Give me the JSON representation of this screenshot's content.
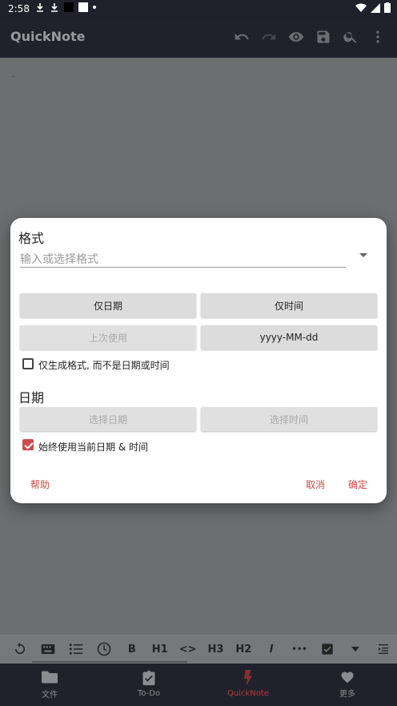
{
  "status_bar": {
    "time": "2:58"
  },
  "app_bar": {
    "title": "QuickNote"
  },
  "dialog": {
    "format_heading": "格式",
    "format_placeholder": "输入或选择格式",
    "buttons": {
      "date_only": "仅日期",
      "time_only": "仅时间",
      "last_used": "上次使用",
      "preset": "yyyy-MM-dd"
    },
    "format_only_checkbox": {
      "label": "仅生成格式, 而不是日期或时间",
      "checked": false
    },
    "date_heading": "日期",
    "select_date": "选择日期",
    "select_time": "选择时间",
    "always_current_checkbox": {
      "label": "始终使用当前日期 & 时间",
      "checked": true
    },
    "help": "帮助",
    "cancel": "取消",
    "ok": "确定"
  },
  "editor": {
    "content": "-"
  },
  "toolbar": {
    "items": [
      "B",
      "H1",
      "<>",
      "H3",
      "H2",
      "I",
      "•••"
    ]
  },
  "bottom_nav": {
    "tabs": [
      {
        "label": "文件",
        "icon": "folder-icon"
      },
      {
        "label": "To-Do",
        "icon": "clipboard-check-icon"
      },
      {
        "label": "QuickNote",
        "icon": "flash-icon",
        "active": true
      },
      {
        "label": "更多",
        "icon": "heart-icon"
      }
    ]
  },
  "colors": {
    "accent": "#d14a4a",
    "appbar": "#1f222b",
    "dim_overlay": "#6d6e70"
  }
}
